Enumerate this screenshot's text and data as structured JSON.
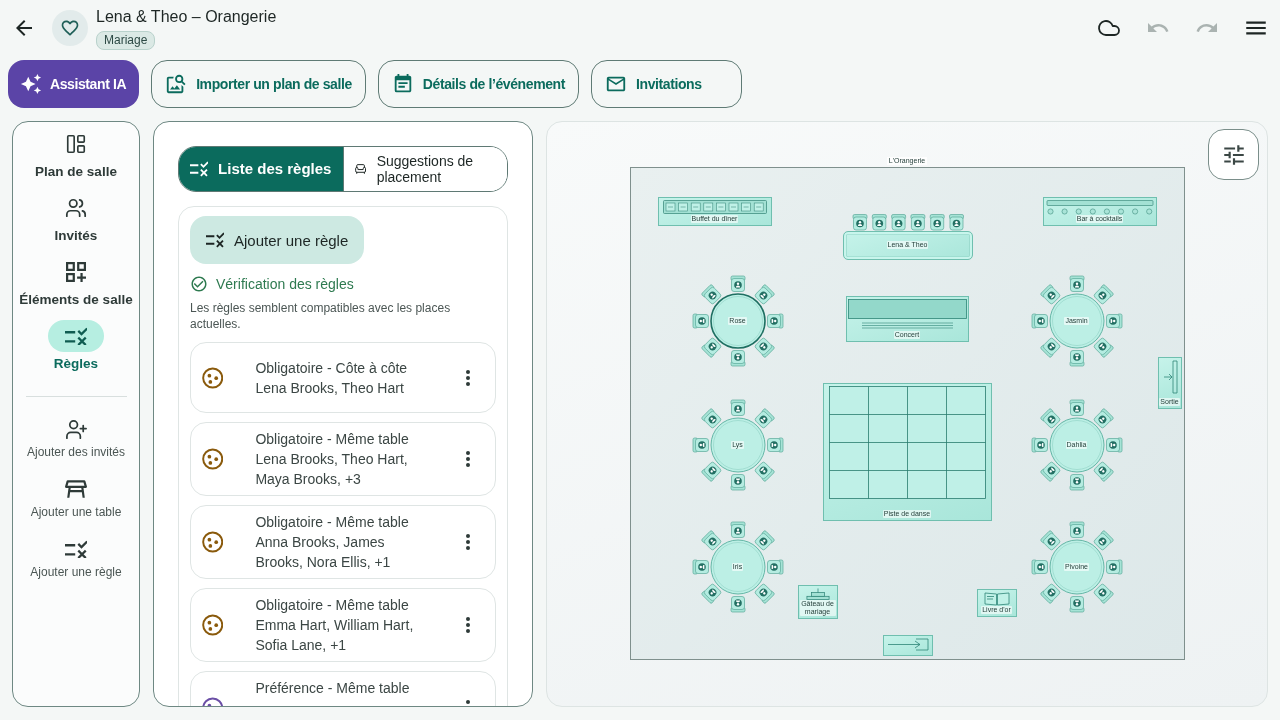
{
  "header": {
    "title": "Lena & Theo – Orangerie",
    "tag": "Mariage"
  },
  "header_actions": [
    {
      "kind": "cloud",
      "disabled": false
    },
    {
      "kind": "undo",
      "disabled": true
    },
    {
      "kind": "redo",
      "disabled": true
    },
    {
      "kind": "menu",
      "disabled": false
    }
  ],
  "action_buttons": [
    {
      "kind": "assistant",
      "label": "Assistant IA"
    },
    {
      "kind": "import",
      "label": "Importer un plan de salle"
    },
    {
      "kind": "event",
      "label": "Détails de l’événement"
    },
    {
      "kind": "mail",
      "label": "Invitations"
    }
  ],
  "nav": {
    "items": [
      {
        "kind": "layout",
        "label": "Plan de salle",
        "selected": false
      },
      {
        "kind": "guests",
        "label": "Invités",
        "selected": false
      },
      {
        "kind": "elements",
        "label": "Éléments de salle",
        "selected": false
      },
      {
        "kind": "rules",
        "label": "Règles",
        "selected": true
      }
    ],
    "actions": [
      {
        "kind": "add_guest",
        "label": "Ajouter des invités"
      },
      {
        "kind": "add_table",
        "label": "Ajouter une table"
      },
      {
        "kind": "add_rule",
        "label": "Ajouter une règle"
      }
    ]
  },
  "rules_panel": {
    "tabs": [
      {
        "kind": "list",
        "label": "Liste des règles",
        "selected": true
      },
      {
        "kind": "seat",
        "label": "Suggestions de placement",
        "selected": false
      }
    ],
    "add_button": "Ajouter une règle",
    "check": {
      "ok": true,
      "title": "Vérification des règles",
      "message": "Les règles semblent compatibles avec les places actuelles."
    },
    "rules": [
      {
        "title": "Obligatoire - Côte à côte",
        "guests": "Lena Brooks, Theo Hart",
        "color": "#8a5a0c"
      },
      {
        "title": "Obligatoire - Même table",
        "guests": "Lena Brooks, Theo Hart, Maya Brooks, +3",
        "color": "#8a5a0c"
      },
      {
        "title": "Obligatoire - Même table",
        "guests": "Anna Brooks, James Brooks, Nora Ellis, +1",
        "color": "#8a5a0c"
      },
      {
        "title": "Obligatoire - Même table",
        "guests": "Emma Hart, William Hart, Sofia Lane, +1",
        "color": "#8a5a0c"
      },
      {
        "title": "Préférence - Même table",
        "color": "#6b4fa6"
      }
    ]
  },
  "floor_plan": {
    "room": "L'Orangerie",
    "elements": [
      {
        "kind": "buffet",
        "label": "Buffet du dîner",
        "selected": false
      },
      {
        "kind": "head_table",
        "label": "Lena & Theo",
        "selected": false
      },
      {
        "kind": "bar",
        "label": "Bar à cocktails",
        "selected": false
      },
      {
        "kind": "round_table",
        "label": "Rose",
        "selected": true
      },
      {
        "kind": "stage",
        "label": "Concert",
        "selected": false
      },
      {
        "kind": "round_table",
        "label": "Jasmin",
        "selected": false
      },
      {
        "kind": "exit",
        "label": "Sortie",
        "selected": false
      },
      {
        "kind": "round_table",
        "label": "Lys",
        "selected": false
      },
      {
        "kind": "dance_floor",
        "label": "Piste de danse",
        "selected": false
      },
      {
        "kind": "round_table",
        "label": "Dahlia",
        "selected": false
      },
      {
        "kind": "round_table",
        "label": "Iris",
        "selected": false
      },
      {
        "kind": "round_table",
        "label": "Pivoine",
        "selected": false
      },
      {
        "kind": "cake",
        "label": "Gâteau de mariage",
        "selected": false
      },
      {
        "kind": "guestbook",
        "label": "Livre d'or",
        "selected": false
      },
      {
        "kind": "entrance",
        "selected": false
      }
    ]
  }
}
